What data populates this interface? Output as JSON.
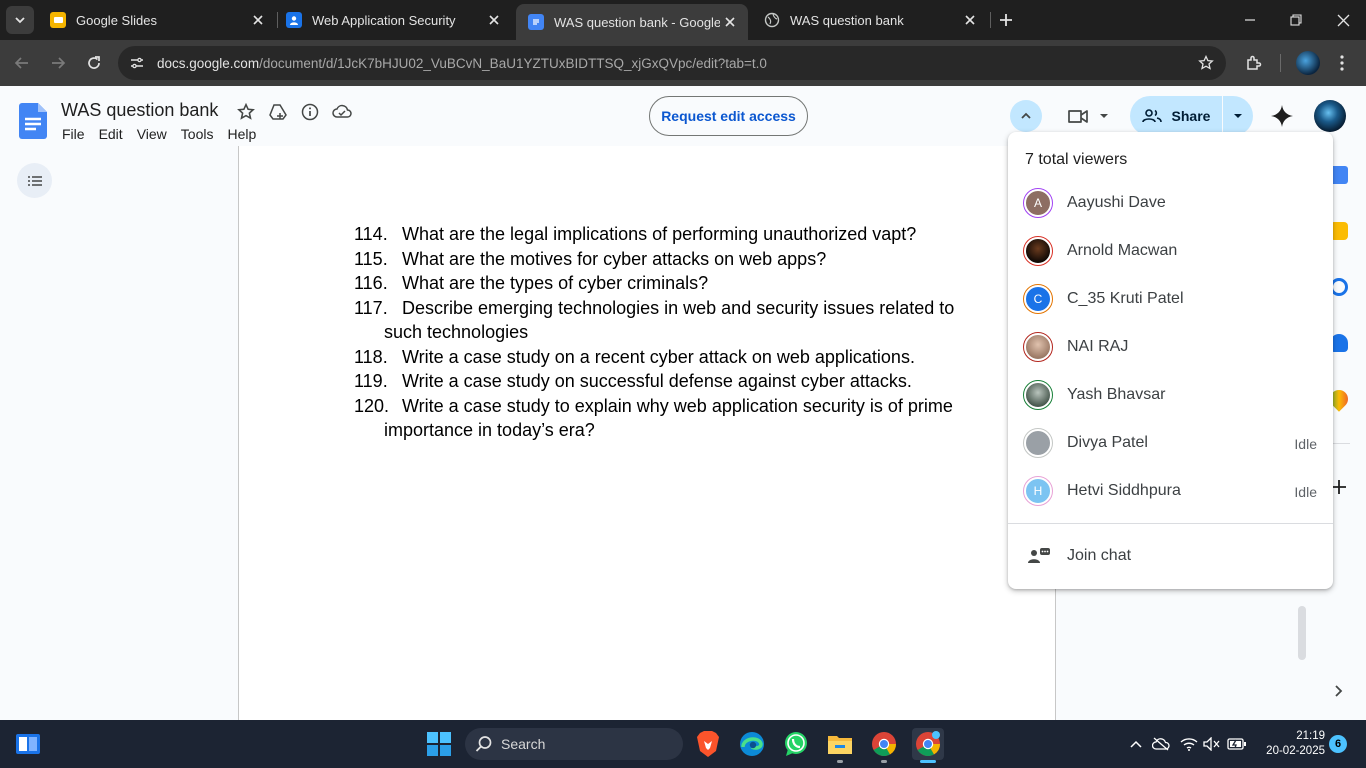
{
  "browser": {
    "tabs": [
      {
        "title": "Google Slides",
        "favicon": "slides-icon",
        "active": false
      },
      {
        "title": "Web Application Security",
        "favicon": "classroom-icon",
        "active": false
      },
      {
        "title": "WAS question bank - Google Do",
        "favicon": "docs-icon",
        "active": true
      },
      {
        "title": "WAS question bank",
        "favicon": "globe-icon",
        "active": false
      }
    ],
    "url_host": "docs.google.com",
    "url_path": "/document/d/1JcK7bHJU02_VuBCvN_BaU1YZTUxBIDTTSQ_xjGxQVpc/edit?tab=t.0"
  },
  "docs": {
    "title": "WAS question bank",
    "menu": [
      "File",
      "Edit",
      "View",
      "Tools",
      "Help"
    ],
    "request_edit_label": "Request edit access",
    "share_label": "Share"
  },
  "document": {
    "questions": [
      {
        "num": "114.",
        "text": "What are the legal implications of performing unauthorized vapt?"
      },
      {
        "num": "115.",
        "text": "What are the motives for cyber attacks on web apps?"
      },
      {
        "num": "116.",
        "text": "What are the types of cyber criminals?"
      },
      {
        "num": "117.",
        "text": "Describe emerging technologies in web and security issues related to such technologies"
      },
      {
        "num": "118.",
        "text": "Write a case study on a recent cyber attack on web applications."
      },
      {
        "num": "119.",
        "text": "Write a case study on successful defense against cyber attacks."
      },
      {
        "num": "120.",
        "text": "Write a case study to explain why web application security is of prime importance in today’s era?"
      }
    ]
  },
  "viewers_popup": {
    "heading": "7 total viewers",
    "viewers": [
      {
        "name": "Aayushi Dave",
        "initial": "A",
        "status": "",
        "color": "#8d6e63",
        "ring": "#a142f4"
      },
      {
        "name": "Arnold Macwan",
        "initial": "",
        "status": "",
        "color": "#2b1a12",
        "ring": "#d93025"
      },
      {
        "name": "C_35 Kruti Patel",
        "initial": "C",
        "status": "",
        "color": "#1a73e8",
        "ring": "#e37400"
      },
      {
        "name": "NAI RAJ",
        "initial": "",
        "status": "",
        "color": "#c9a68d",
        "ring": "#b3261e"
      },
      {
        "name": "Yash Bhavsar",
        "initial": "",
        "status": "",
        "color": "#5b7063",
        "ring": "#188038"
      },
      {
        "name": "Divya Patel",
        "initial": "",
        "status": "Idle",
        "color": "#9aa0a6",
        "ring": "#c4c7c5"
      },
      {
        "name": "Hetvi Siddhpura",
        "initial": "H",
        "status": "Idle",
        "color": "#7cc4f2",
        "ring": "#e8a2d6"
      }
    ],
    "join_chat_label": "Join chat"
  },
  "taskbar": {
    "search_label": "Search",
    "time": "21:19",
    "date": "20-02-2025",
    "notifications": "6"
  },
  "colors": {
    "accent": "#0b57d0",
    "share_bg": "#c2e7ff",
    "taskbar_bg": "#1c2433"
  }
}
